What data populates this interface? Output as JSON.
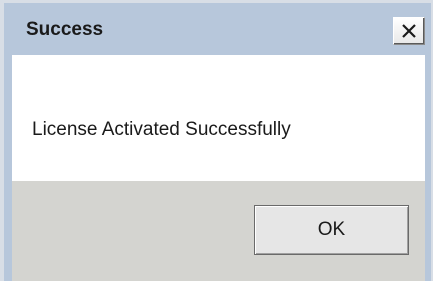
{
  "window": {
    "title": "Success",
    "close_icon": "close-x-icon"
  },
  "message": {
    "text": "License Activated Successfully"
  },
  "buttons": {
    "ok_label": "OK"
  },
  "colors": {
    "frame": "#b7c7db",
    "body_bg": "#ffffff",
    "footer_bg": "#d4d4d0",
    "button_bg": "#e6e6e6"
  }
}
